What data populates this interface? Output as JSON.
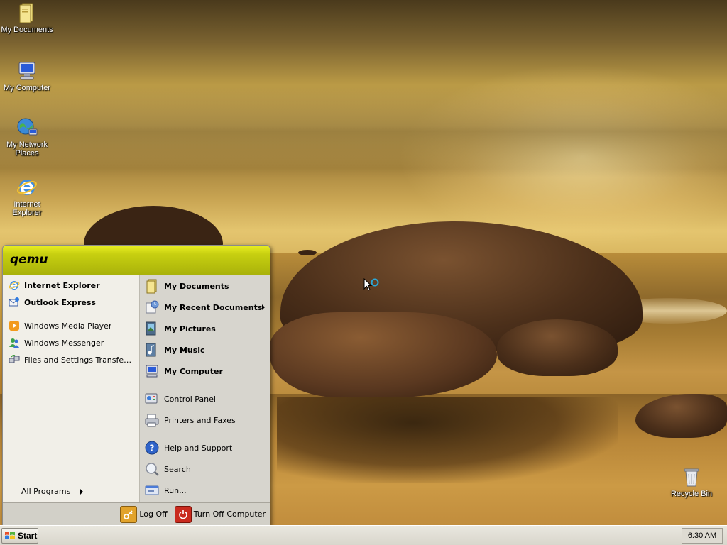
{
  "desktop": {
    "icons": [
      {
        "label": "My Documents",
        "icon": "my-documents-icon"
      },
      {
        "label": "My Computer",
        "icon": "my-computer-icon"
      },
      {
        "label": "My Network Places",
        "icon": "network-places-icon"
      },
      {
        "label": "Internet Explorer",
        "icon": "internet-explorer-icon"
      },
      {
        "label": "Recycle Bin",
        "icon": "recycle-bin-icon"
      }
    ]
  },
  "start_menu": {
    "user_name": "qemu",
    "pinned": [
      {
        "label": "Internet Explorer",
        "icon": "internet-explorer-icon"
      },
      {
        "label": "Outlook Express",
        "icon": "outlook-express-icon"
      }
    ],
    "recent_programs": [
      {
        "label": "Windows Media Player",
        "icon": "media-player-icon"
      },
      {
        "label": "Windows Messenger",
        "icon": "messenger-icon"
      },
      {
        "label": "Files and Settings Transfer Wi...",
        "icon": "transfer-wizard-icon"
      }
    ],
    "all_programs_label": "All Programs",
    "right_top": [
      {
        "label": "My Documents",
        "icon": "my-documents-icon"
      },
      {
        "label": "My Recent Documents",
        "icon": "recent-documents-icon"
      },
      {
        "label": "My Pictures",
        "icon": "my-pictures-icon"
      },
      {
        "label": "My Music",
        "icon": "my-music-icon"
      },
      {
        "label": "My Computer",
        "icon": "my-computer-icon"
      }
    ],
    "right_middle": [
      {
        "label": "Control Panel",
        "icon": "control-panel-icon"
      },
      {
        "label": "Printers and Faxes",
        "icon": "printer-icon"
      }
    ],
    "right_bottom": [
      {
        "label": "Help and Support",
        "icon": "help-icon"
      },
      {
        "label": "Search",
        "icon": "search-icon"
      },
      {
        "label": "Run...",
        "icon": "run-icon"
      }
    ],
    "log_off_label": "Log Off",
    "turn_off_label": "Turn Off Computer"
  },
  "taskbar": {
    "start_label": "Start",
    "clock": "6:30 AM"
  },
  "colors": {
    "header_accent": "#c7cf10",
    "menu_left_bg": "#f1efe8",
    "menu_right_bg": "#d7d5ce",
    "taskbar_bg": "#dedbd2"
  }
}
